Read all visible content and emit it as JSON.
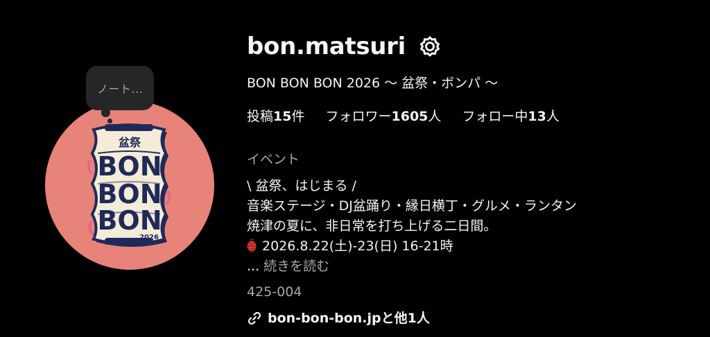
{
  "note": {
    "text": "ノート..."
  },
  "profile": {
    "username": "bon.matsuri",
    "full_name": "BON BON BON 2026 〜 盆祭・ボンパ 〜",
    "stats": {
      "posts_label": "投稿",
      "posts_count": "15",
      "posts_unit": "件",
      "followers_label": "フォロワー",
      "followers_count": "1605",
      "followers_unit": "人",
      "following_label": "フォロー中",
      "following_count": "13",
      "following_unit": "人"
    },
    "category": "イベント",
    "bio": {
      "line1": "\\ 盆祭、はじまる /",
      "line2": "音楽ステージ・DJ盆踊り・縁日横丁・グルメ・ランタン",
      "line3": "焼津の夏に、非日常を打ち上げる二日間。",
      "line4": "2026.8.22(土)-23(日) 16-21時"
    },
    "more": {
      "ellipsis": "...",
      "label": "続きを読む"
    },
    "postal_code": "425-004",
    "link_text": "bon-bon-bon.jpと他1人"
  },
  "avatar_logo": {
    "top_text": "盆祭",
    "line1": "BON",
    "line2": "BON",
    "line3": "BON",
    "year": "2026"
  },
  "icons": {
    "settings": "gear-icon",
    "lantern": "lantern-icon",
    "link": "link-icon"
  },
  "colors": {
    "background": "#000000",
    "text_primary": "#f5f5f5",
    "text_secondary": "#a8a8a8",
    "avatar_bg": "#e8837a",
    "logo_navy": "#1f2a5a",
    "logo_cream": "#f4ecd8",
    "bubble_bg": "#262626"
  }
}
